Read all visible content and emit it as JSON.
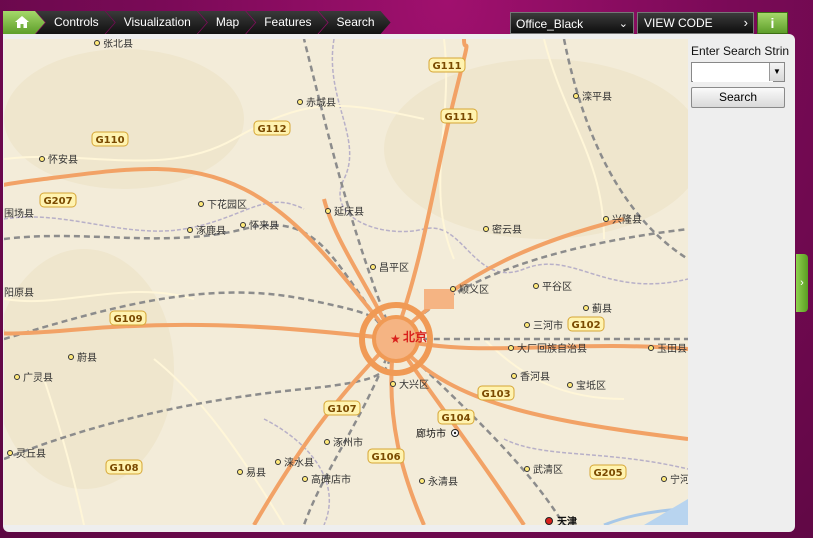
{
  "breadcrumb": {
    "home_icon": "home-icon",
    "items": [
      "Controls",
      "Visualization",
      "Map",
      "Features",
      "Search"
    ]
  },
  "theme_selector": {
    "value": "Office_Black"
  },
  "view_code": {
    "label": "VIEW CODE"
  },
  "info_button": {
    "label": "i"
  },
  "search_panel": {
    "label": "Enter Search Strin",
    "input_value": "",
    "button_label": "Search"
  },
  "map": {
    "highways": [
      "G111",
      "G111",
      "G110",
      "G112",
      "G207",
      "G109",
      "G102",
      "G107",
      "G104",
      "G103",
      "G106",
      "G108",
      "G205"
    ],
    "places": [
      "张北县",
      "赤城县",
      "滦平县",
      "怀安县",
      "下花园区",
      "延庆县",
      "涿鹿县",
      "怀来县",
      "密云县",
      "兴隆县",
      "昌平区",
      "顺义区",
      "平谷区",
      "蓟县",
      "阳原县",
      "三河市",
      "蔚县",
      "北京",
      "大厂回族自治县",
      "玉田县",
      "广灵县",
      "香河县",
      "大兴区",
      "宝坻区",
      "涿州市",
      "廊坊市",
      "灵丘县",
      "涞水县",
      "易县",
      "高碑店市",
      "永清县",
      "武清区",
      "宁河",
      "天津",
      "围场县"
    ],
    "colors": {
      "land": "#f3ecd9",
      "highway": "#f2a266",
      "urban": "#f09a55",
      "capital": "#d9201c"
    }
  }
}
